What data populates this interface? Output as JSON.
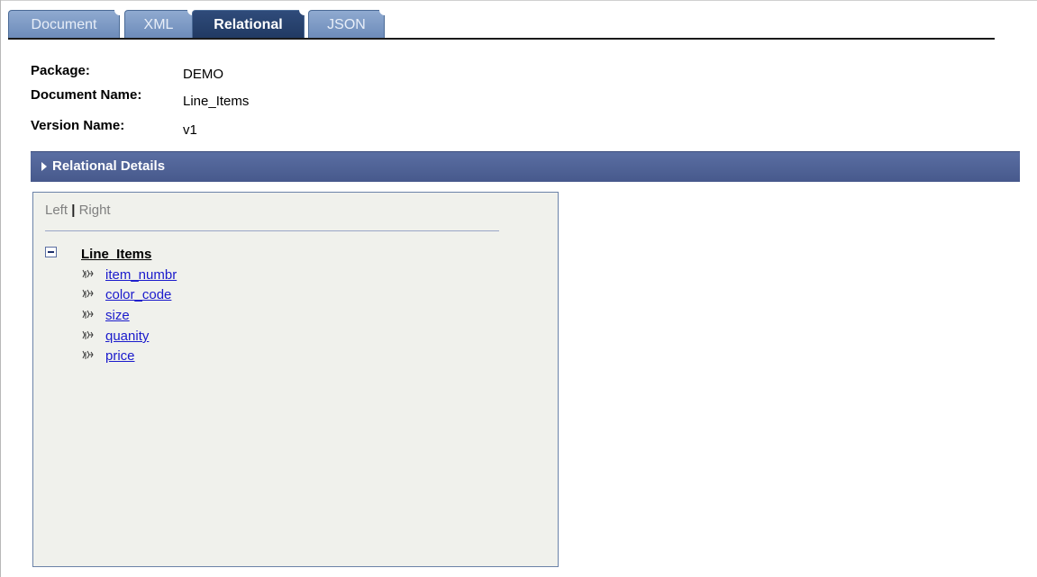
{
  "tabs": [
    {
      "label": "Document",
      "active": false
    },
    {
      "label": "XML",
      "active": false
    },
    {
      "label": "Relational",
      "active": true
    },
    {
      "label": "JSON",
      "active": false
    }
  ],
  "info": {
    "package_label": "Package:",
    "package_value": "DEMO",
    "document_name_label": "Document Name:",
    "document_name_value": "Line_Items",
    "version_name_label": "Version Name:",
    "version_name_value": "v1"
  },
  "section": {
    "title": "Relational Details",
    "icon": "expand-arrow-icon"
  },
  "panel": {
    "left_label": "Left",
    "separator": "|",
    "right_label": "Right",
    "tree": {
      "root_label": "Line_Items",
      "root_icon": "collapse-icon",
      "children": [
        {
          "label": "item_numbr",
          "icon": "element-node-icon"
        },
        {
          "label": "color_code",
          "icon": "element-node-icon"
        },
        {
          "label": "size",
          "icon": "element-node-icon"
        },
        {
          "label": "quanity",
          "icon": "element-node-icon"
        },
        {
          "label": "price",
          "icon": "element-node-icon"
        }
      ]
    }
  },
  "colors": {
    "tab_active": "#213a63",
    "tab_inactive": "#7f9cc6",
    "section_bar": "#4f6296",
    "panel_bg": "#f0f1ec",
    "link": "#1a1acc"
  }
}
